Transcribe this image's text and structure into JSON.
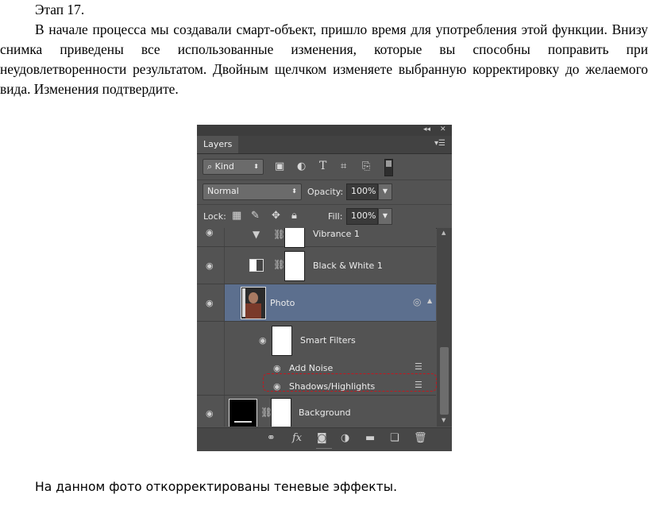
{
  "document": {
    "stage": "Этап 17.",
    "paragraph": "В начале процесса мы создавали смарт-объект, пришло время для употребления этой функции. Внизу снимка приведены все использованные изменения, которые вы способны поправить при неудовлетворенности результатом. Двойным щелчком изменяете выбранную корректировку до желаемого вида. Изменения подтвердите.",
    "caption": "На данном фото откорректированы теневые эффекты."
  },
  "panel": {
    "collapse_icon": "double-chevron-left-icon",
    "close_icon": "close-icon",
    "tab": "Layers",
    "menu_icon": "panel-menu-icon",
    "filter": {
      "kind_label": "Kind",
      "icons": [
        "pixel-filter-icon",
        "adjustment-filter-icon",
        "type-filter-icon",
        "shape-filter-icon",
        "smart-object-filter-icon"
      ]
    },
    "blend_mode": "Normal",
    "opacity_label": "Opacity:",
    "opacity_value": "100%",
    "lock_label": "Lock:",
    "fill_label": "Fill:",
    "fill_value": "100%",
    "layers": [
      {
        "name": "Vibrance 1"
      },
      {
        "name": "Black & White 1"
      },
      {
        "name": "Photo"
      },
      {
        "name": "Smart Filters"
      },
      {
        "name": "Add Noise"
      },
      {
        "name": "Shadows/Highlights"
      },
      {
        "name": "Background"
      }
    ],
    "footer_icons": [
      "link-layers-icon",
      "fx-icon",
      "add-mask-icon",
      "adjustment-layer-icon",
      "group-folder-icon",
      "new-layer-icon",
      "trash-icon"
    ]
  },
  "colors": {
    "panel_bg": "#535353",
    "selected_row": "#5c6f8e",
    "highlight_dash": "#c3171f"
  }
}
